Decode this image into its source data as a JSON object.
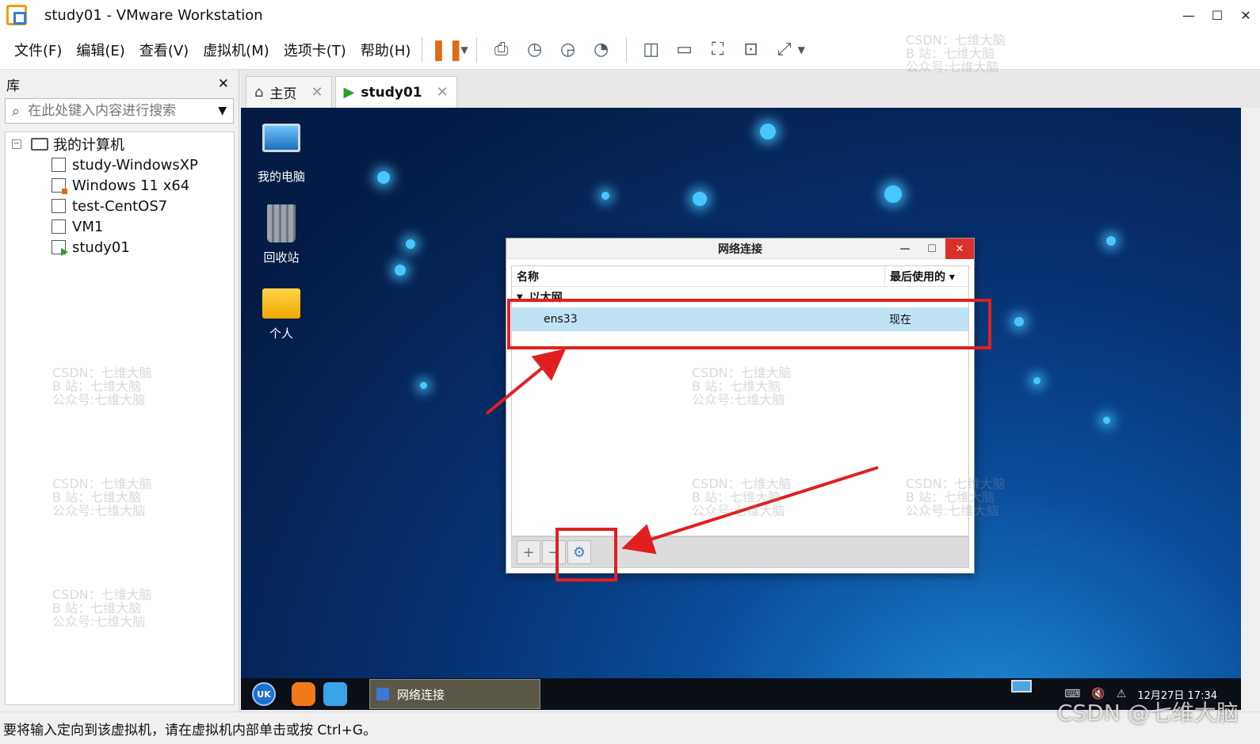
{
  "window": {
    "title": "study01 - VMware Workstation",
    "controls": [
      "—",
      "☐",
      "✕"
    ]
  },
  "menu": [
    "文件(F)",
    "编辑(E)",
    "查看(V)",
    "虚拟机(M)",
    "选项卡(T)",
    "帮助(H)"
  ],
  "library": {
    "title": "库",
    "close": "✕",
    "search_placeholder": "在此处键入内容进行搜索",
    "root": "我的计算机",
    "items": [
      "study-WindowsXP",
      "Windows 11 x64",
      "test-CentOS7",
      "VM1",
      "study01"
    ]
  },
  "tabs": [
    {
      "label": "主页",
      "close": "✕"
    },
    {
      "label": "study01",
      "close": "✕"
    }
  ],
  "desktop_icons": [
    "我的电脑",
    "回收站",
    "个人"
  ],
  "dialog": {
    "title": "网络连接",
    "columns": [
      "名称",
      "最后使用的 ▾"
    ],
    "group": "以太网",
    "rows": [
      {
        "name": "ens33",
        "last_used": "现在"
      }
    ],
    "footer_buttons": [
      "+",
      "−",
      "⚙"
    ]
  },
  "guest_taskbar": {
    "uk_label": "UK",
    "task": "网络连接",
    "clock": "12月27日 17:34"
  },
  "statusbar": "要将输入定向到该虚拟机，请在虚拟机内部单击或按 Ctrl+G。",
  "watermark": "CSDN：七维大脑\nB 站：七维大脑\n公众号:七维大脑",
  "corner_watermark": "CSDN @七维大脑",
  "colors": {
    "annotation": "#e02020",
    "selection": "#bfe3f5",
    "accent": "#e06a1a"
  }
}
